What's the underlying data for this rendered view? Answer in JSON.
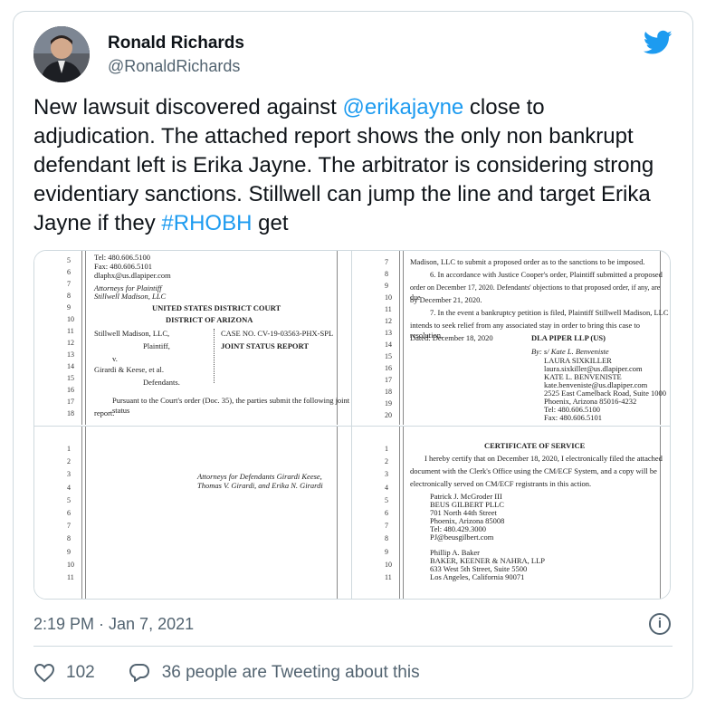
{
  "tweet": {
    "author_name": "Ronald Richards",
    "author_handle": "@RonaldRichards",
    "text_prefix": "New lawsuit discovered against ",
    "mention": "@erikajayne",
    "text_middle": " close to adjudication.  The attached report shows the only non bankrupt defendant left is Erika Jayne.  The arbitrator is considering strong evidentiary sanctions. Stillwell can jump the line and target Erika Jayne if they ",
    "hashtag": "#RHOBH",
    "text_suffix": " get",
    "timestamp": "2:19 PM · Jan 7, 2021",
    "like_count": "102",
    "reply_text": "36 people are Tweeting about this"
  },
  "document": {
    "p1": {
      "lines": [
        "5",
        "6",
        "7",
        "8",
        "9",
        "10",
        "11",
        "12",
        "13",
        "14",
        "15",
        "16",
        "17",
        "18"
      ],
      "tel": "Tel: 480.606.5100",
      "fax": "Fax: 480.606.5101",
      "email": "dlaphx@us.dlapiper.com",
      "attorneys": "Attorneys for Plaintiff",
      "plaintiff_firm": "Stillwell Madison, LLC",
      "court": "UNITED STATES DISTRICT COURT",
      "district": "DISTRICT OF ARIZONA",
      "party1": "Stillwell Madison, LLC,",
      "role1": "Plaintiff,",
      "versus": "v.",
      "party2": "Girardi & Keese, et al.",
      "role2": "Defendants.",
      "case_no": "CASE NO. CV-19-03563-PHX-SPL",
      "report_title": "JOINT STATUS REPORT",
      "body1": "Pursuant to the Court's order (Doc. 35), the parties submit the following joint status",
      "body2": "report."
    },
    "p2": {
      "lines": [
        "7",
        "8",
        "9",
        "10",
        "11",
        "12",
        "13",
        "14",
        "15",
        "16",
        "17",
        "18",
        "19",
        "20"
      ],
      "t1": "Madison, LLC to submit a proposed order as to the sanctions to be imposed.",
      "t2": "6.      In accordance with Justice Cooper's order, Plaintiff submitted a proposed",
      "t3": "order on December 17, 2020.  Defendants' objections to that proposed order, if any, are due",
      "t4": "by December 21, 2020.",
      "t5": "7.      In the event a bankruptcy petition is filed, Plaintiff Stillwell Madison, LLC",
      "t6": "intends to seek relief from any associated stay in order to bring this case to resolution.",
      "dated": "Dated: December 18, 2020",
      "firm": "DLA PIPER LLP (US)",
      "by": "By: s/ Kate L. Benveniste",
      "sig1": "LAURA SIXKILLER",
      "sig2": "laura.sixkiller@us.dlapiper.com",
      "sig3": "KATE L. BENVENISTE",
      "sig4": "kate.benveniste@us.dlapiper.com",
      "sig5": "2525 East Camelback Road, Suite 1000",
      "sig6": "Phoenix, Arizona 85016-4232",
      "sig7": "Tel: 480.606.5100",
      "sig8": "Fax: 480.606.5101"
    },
    "p3": {
      "lines": [
        "1",
        "2",
        "3",
        "4",
        "5",
        "6",
        "7",
        "8",
        "9",
        "10",
        "11"
      ],
      "attys1": "Attorneys for Defendants Girardi Keese,",
      "attys2": "Thomas V. Girardi, and Erika N. Girardi"
    },
    "p4": {
      "lines": [
        "1",
        "2",
        "3",
        "4",
        "5",
        "6",
        "7",
        "8",
        "9",
        "10",
        "11"
      ],
      "title": "CERTIFICATE OF SERVICE",
      "c1": "I hereby certify that on December 18, 2020, I electronically filed the attached",
      "c2": "document with the Clerk's Office using the CM/ECF System, and a copy will be",
      "c3": "electronically served on CM/ECF registrants in this action.",
      "a1": "Patrick J. McGroder III",
      "a2": "BEUS GILBERT PLLC",
      "a3": "701 North 44th Street",
      "a4": "Phoenix, Arizona 85008",
      "a5": "Tel: 480.429.3000",
      "a6": "PJ@beusgilbert.com",
      "b1": "Phillip A. Baker",
      "b2": "BAKER, KEENER & NAHRA, LLP",
      "b3": "633 West 5th Street, Suite 5500",
      "b4": "Los Angeles, California 90071"
    }
  },
  "colors": {
    "link": "#1d9bf0",
    "twitter_blue": "#1d9bf0",
    "secondary_text": "#536471",
    "border": "#cfd9de"
  },
  "icons": [
    "twitter-bird-icon",
    "info-icon",
    "heart-icon",
    "reply-icon"
  ]
}
